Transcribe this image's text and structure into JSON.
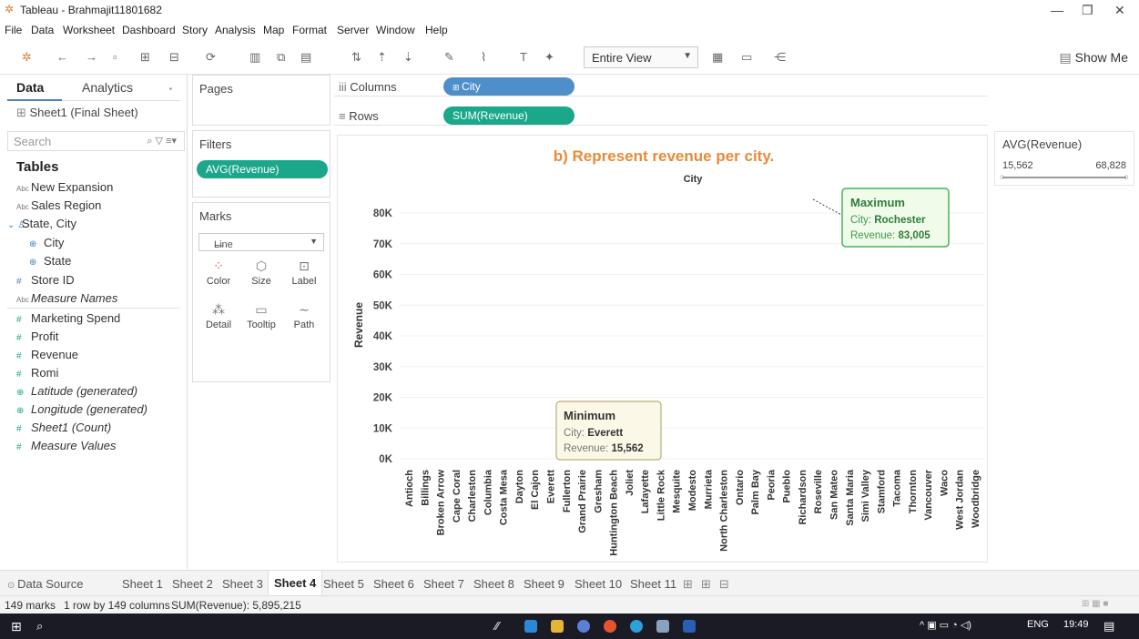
{
  "window": {
    "title": "Tableau - Brahmajit11801682",
    "minimize": "—",
    "restore": "❐",
    "close": "✕"
  },
  "menu": [
    "File",
    "Data",
    "Worksheet",
    "Dashboard",
    "Story",
    "Analysis",
    "Map",
    "Format",
    "Server",
    "Window",
    "Help"
  ],
  "toolbar": {
    "fit": "Entire View",
    "show_me": "Show Me"
  },
  "data_pane": {
    "tabs": [
      "Data",
      "Analytics"
    ],
    "source": "Sheet1 (Final Sheet)",
    "search_placeholder": "Search",
    "tables_heading": "Tables",
    "dimensions": [
      {
        "name": "New Expansion",
        "type": "Abc"
      },
      {
        "name": "Sales Region",
        "type": "Abc"
      },
      {
        "name": "State, City",
        "type": "hier"
      },
      {
        "name": "City",
        "type": "geo"
      },
      {
        "name": "State",
        "type": "geo"
      },
      {
        "name": "Store ID",
        "type": "num"
      },
      {
        "name": "Measure Names",
        "type": "Abc"
      }
    ],
    "measures": [
      {
        "name": "Marketing Spend"
      },
      {
        "name": "Profit"
      },
      {
        "name": "Revenue"
      },
      {
        "name": "Romi"
      },
      {
        "name": "Latitude (generated)"
      },
      {
        "name": "Longitude (generated)"
      },
      {
        "name": "Sheet1 (Count)"
      },
      {
        "name": "Measure Values"
      }
    ]
  },
  "pages": {
    "label": "Pages"
  },
  "filters": {
    "label": "Filters",
    "pill": "AVG(Revenue)"
  },
  "marks": {
    "label": "Marks",
    "type": "Line",
    "buttons": [
      "Color",
      "Size",
      "Label",
      "Detail",
      "Tooltip",
      "Path"
    ]
  },
  "shelves": {
    "columns_label": "Columns",
    "columns_pill": "City",
    "rows_label": "Rows",
    "rows_pill": "SUM(Revenue)"
  },
  "legend": {
    "title": "AVG(Revenue)",
    "min": "15,562",
    "max": "68,828"
  },
  "sheet_tabs": {
    "data_source": "Data Source",
    "tabs": [
      "Sheet 1",
      "Sheet 2",
      "Sheet 3",
      "Sheet 4",
      "Sheet 5",
      "Sheet 6",
      "Sheet 7",
      "Sheet 8",
      "Sheet 9",
      "Sheet 10",
      "Sheet 11"
    ],
    "active": "Sheet 4"
  },
  "status": {
    "marks": "149 marks",
    "grid": "1 row by 149 columns",
    "sum": "SUM(Revenue): 5,895,215"
  },
  "taskbar": {
    "lang": "ENG",
    "time": "19:49"
  },
  "chart_data": {
    "type": "line",
    "title": "b) Represent revenue per city.",
    "header": "City",
    "ylabel": "Revenue",
    "ylim": [
      0,
      80000
    ],
    "yticks": [
      "0K",
      "10K",
      "20K",
      "30K",
      "40K",
      "50K",
      "60K",
      "70K",
      "80K"
    ],
    "line_color": "#4e79a7",
    "x_labels": [
      "Antioch",
      "Billings",
      "Broken Arrow",
      "Cape Coral",
      "Charleston",
      "Columbia",
      "Costa Mesa",
      "Dayton",
      "El Cajon",
      "Everett",
      "Fullerton",
      "Grand Prairie",
      "Gresham",
      "Huntington Beach",
      "Joliet",
      "Lafayette",
      "Little Rock",
      "Mesquite",
      "Modesto",
      "Murrieta",
      "North Charleston",
      "Ontario",
      "Palm Bay",
      "Peoria",
      "Pueblo",
      "Richardson",
      "Roseville",
      "San Mateo",
      "Santa Maria",
      "Simi Valley",
      "Stamford",
      "Tacoma",
      "Thornton",
      "Vancouver",
      "Waco",
      "West Jordan",
      "Woodbridge"
    ],
    "marks_count": 149,
    "annotations": [
      {
        "title": "Maximum",
        "city_label": "City:",
        "city": "Rochester",
        "rev_label": "Revenue:",
        "revenue": "83,005",
        "value": 83005
      },
      {
        "title": "Minimum",
        "city_label": "City:",
        "city": "Everett",
        "rev_label": "Revenue:",
        "revenue": "15,562",
        "value": 15562
      }
    ]
  }
}
